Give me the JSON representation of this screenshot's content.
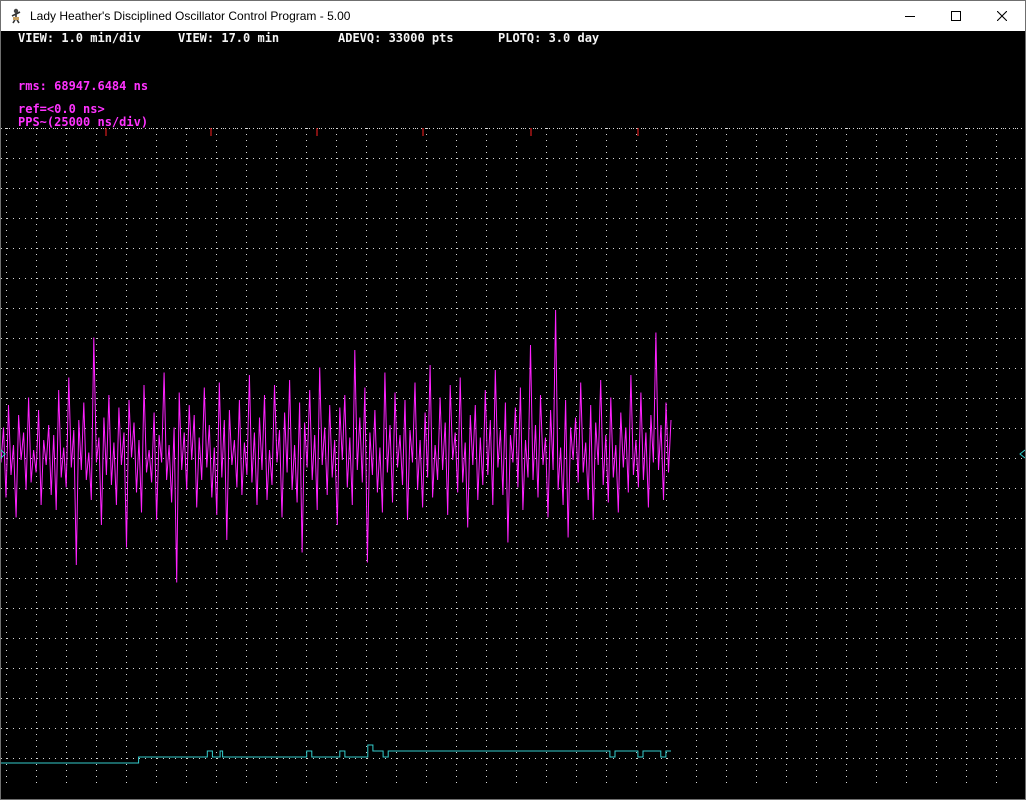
{
  "window": {
    "title": "Lady Heather's Disciplined Oscillator Control Program - 5.00",
    "icon": "figure-icon",
    "controls": [
      "minimize-icon",
      "maximize-icon",
      "close-icon"
    ]
  },
  "status_line": {
    "view_rate": "VIEW: 1.0 min/div",
    "view_span": "VIEW: 17.0 min",
    "adevq": "ADEVQ: 33000 pts",
    "plotq": "PLOTQ: 3.0 day"
  },
  "stats": {
    "rms": "rms: 68947.6484 ns",
    "ref": "ref=<0.0 ns>",
    "pps_scale": "PPS~(25000 ns/div)"
  },
  "colors": {
    "background": "#000000",
    "grid": "#d8d8d8",
    "pps_trace": "#ff22ff",
    "secondary_trace": "#33cccc",
    "marker": "#ff2222",
    "text_white": "#f4f4f4",
    "text_magenta": "#ff33ff"
  },
  "chart_data": {
    "type": "line",
    "grid": true,
    "series": [
      {
        "values": [
          -0.3,
          1.1,
          -1.7,
          2.0,
          -0.8,
          0.4,
          -2.5,
          1.6,
          -0.2,
          0.9,
          -1.4,
          2.3,
          -1.1,
          0.2,
          -0.7,
          1.8,
          -2.0,
          0.6,
          -0.4,
          1.2,
          -1.6,
          0.8,
          -2.2,
          2.6,
          -0.9,
          0.3,
          -1.3,
          3.1,
          -0.5,
          1.0,
          -4.4,
          1.4,
          -0.6,
          2.1,
          -1.0,
          0.1,
          -1.8,
          4.7,
          -0.3,
          0.7,
          -2.8,
          1.5,
          -0.8,
          2.4,
          -1.2,
          0.5,
          -2.0,
          1.9,
          -0.4,
          0.9,
          -3.7,
          2.2,
          -0.1,
          1.3,
          -1.5,
          0.6,
          -2.3,
          2.8,
          -0.7,
          0.2,
          -1.1,
          1.7,
          -2.6,
          0.8,
          -0.3,
          3.3,
          -1.0,
          0.4,
          -1.9,
          1.1,
          -5.1,
          2.5,
          -0.6,
          0.9,
          -1.4,
          2.0,
          -0.2,
          1.6,
          -2.1,
          0.7,
          -1.0,
          2.7,
          -0.5,
          1.2,
          -1.7,
          0.3,
          -2.4,
          2.9,
          -0.9,
          1.4,
          -3.4,
          1.8,
          -0.4,
          0.6,
          -1.3,
          2.2,
          -1.6,
          0.5,
          -0.8,
          3.2,
          -1.1,
          0.9,
          -2.0,
          1.5,
          -0.6,
          2.4,
          -1.8,
          0.2,
          -1.2,
          2.8,
          -0.3,
          1.0,
          -2.5,
          1.7,
          -0.7,
          3.0,
          -1.4,
          0.4,
          -1.9,
          2.1,
          -3.9,
          1.3,
          -0.5,
          2.6,
          -1.0,
          0.8,
          -2.2,
          3.5,
          -0.4,
          1.1,
          -1.6,
          2.0,
          -0.9,
          0.6,
          -2.8,
          1.9,
          -0.2,
          2.4,
          -1.3,
          0.7,
          -2.0,
          4.2,
          -0.6,
          1.5,
          -1.1,
          2.7,
          -4.3,
          0.9,
          -0.8,
          1.8,
          -1.5,
          0.3,
          -2.3,
          3.3,
          -0.7,
          1.2,
          -1.9,
          2.5,
          -0.5,
          0.8,
          -1.2,
          2.2,
          -2.6,
          1.0,
          -0.3,
          2.9,
          -1.4,
          0.6,
          -2.1,
          1.7,
          -0.9,
          3.6,
          -1.7,
          0.4,
          -1.0,
          2.3,
          -0.6,
          1.3,
          -2.4,
          2.8,
          -0.2,
          0.9,
          -1.5,
          3.1,
          -1.1,
          0.5,
          -2.9,
          1.6,
          -0.4,
          2.0,
          -1.8,
          0.7,
          -1.2,
          2.6,
          -0.8,
          1.4,
          -2.0,
          3.4,
          -0.5,
          1.0,
          -1.6,
          2.1,
          -3.5,
          0.8,
          -0.3,
          1.9,
          -1.3,
          2.7,
          -2.2,
          0.6,
          -0.9,
          4.4,
          -1.0,
          1.2,
          -1.7,
          2.4,
          -0.4,
          0.7,
          -2.5,
          1.8,
          -0.6,
          5.8,
          -1.4,
          0.3,
          -2.0,
          2.2,
          -3.3,
          1.1,
          -0.2,
          1.5,
          -1.1,
          2.9,
          -0.7,
          0.5,
          -1.8,
          2.0,
          -2.6,
          1.3,
          -0.4,
          3.0,
          -1.2,
          0.8,
          -1.9,
          2.3,
          -0.9,
          0.4,
          -2.3,
          1.7,
          -0.5,
          1.1,
          -1.5,
          3.2,
          -0.8,
          0.6,
          -1.3,
          2.5,
          -1.0,
          0.9,
          -2.1,
          1.6,
          -0.3,
          4.9,
          -0.6,
          1.2,
          -1.8,
          2.1,
          -0.7,
          1.4
        ],
        "color": "#ff22ff"
      },
      {
        "values": [
          0,
          0,
          0,
          0,
          0,
          0,
          0,
          0,
          0,
          0,
          0,
          0,
          0,
          0,
          0,
          0,
          0,
          0,
          0,
          0,
          0,
          0,
          0,
          0,
          0,
          0,
          0,
          0,
          0,
          0,
          0,
          0,
          0,
          0,
          0,
          0,
          0,
          0,
          0,
          0,
          0,
          0,
          0,
          0,
          0,
          0,
          0,
          0,
          0,
          0,
          0,
          0,
          0,
          0,
          1,
          1,
          1,
          1,
          1,
          1,
          1,
          1,
          1,
          1,
          1,
          1,
          1,
          1,
          1,
          1,
          1,
          1,
          1,
          1,
          1,
          1,
          1,
          1,
          1,
          1,
          1,
          2,
          2,
          1,
          1,
          1,
          2,
          1,
          1,
          1,
          1,
          1,
          1,
          1,
          1,
          1,
          1,
          1,
          1,
          1,
          1,
          1,
          1,
          1,
          1,
          1,
          1,
          1,
          1,
          1,
          1,
          1,
          1,
          1,
          1,
          1,
          1,
          1,
          1,
          1,
          2,
          2,
          1,
          1,
          1,
          1,
          1,
          1,
          1,
          1,
          1,
          1,
          1,
          2,
          2,
          1,
          1,
          1,
          1,
          1,
          1,
          1,
          1,
          1,
          3,
          3,
          2,
          2,
          2,
          2,
          1,
          1,
          2,
          2,
          2,
          2,
          2,
          2,
          2,
          2,
          2,
          2,
          2,
          2,
          2,
          2,
          2,
          2,
          2,
          2,
          2,
          2,
          2,
          2,
          2,
          2,
          2,
          2,
          2,
          2,
          2,
          2,
          2,
          2,
          2,
          2,
          2,
          2,
          2,
          2,
          2,
          2,
          2,
          2,
          2,
          2,
          2,
          2,
          2,
          2,
          2,
          2,
          2,
          2,
          2,
          2,
          2,
          2,
          2,
          2,
          2,
          2,
          2,
          2,
          2,
          2,
          2,
          2,
          2,
          2,
          2,
          2,
          2,
          2,
          2,
          2,
          2,
          2,
          2,
          2,
          2,
          2,
          2,
          2,
          2,
          2,
          2,
          2,
          2,
          1,
          1,
          2,
          2,
          2,
          2,
          2,
          2,
          2,
          2,
          2,
          1,
          1,
          2,
          2,
          2,
          2,
          2,
          2,
          2,
          1,
          1,
          2,
          2,
          2
        ],
        "color": "#33cccc"
      }
    ]
  }
}
